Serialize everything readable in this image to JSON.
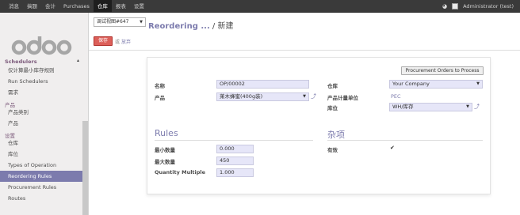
{
  "topbar": {
    "menus": [
      "消息",
      "搞题",
      "会计",
      "Purchases",
      "仓库",
      "报表",
      "设置"
    ],
    "active_menu": "仓库",
    "user": "Administrator (test)"
  },
  "sidebar": {
    "logo": "odoo",
    "sections": [
      {
        "label": "Schedulers",
        "items": [
          "仅计算最小库存规则",
          "Run Schedulers",
          "需求"
        ]
      },
      {
        "label": "产品",
        "items": [
          "产品类别",
          "产品"
        ]
      },
      {
        "label": "设置",
        "items": [
          "仓库",
          "库位",
          "Types of Operation",
          "Reordering Rules",
          "Procurement Rules",
          "Routes"
        ]
      }
    ],
    "active_item": "Reordering Rules"
  },
  "header": {
    "view_selector": "调试视图#647",
    "breadcrumb_parent": "Reordering ...",
    "breadcrumb_sep": " / ",
    "breadcrumb_current": "新建",
    "save_label": "保存",
    "or_label": "或",
    "discard_label": "放弃"
  },
  "form": {
    "procurement_button": "Procurement Orders to Process",
    "name_label": "名称",
    "name_value": "OP/00002",
    "product_label": "产品",
    "product_value": "莱木蜂蜜(400g装)",
    "warehouse_label": "仓库",
    "warehouse_value": "Your Company",
    "uom_label": "产品计量单位",
    "uom_value": "PEC",
    "location_label": "库位",
    "location_value": "WH/库存",
    "rules_heading": "Rules",
    "misc_heading": "杂项",
    "min_qty_label": "最小数量",
    "min_qty_value": "0.000",
    "max_qty_label": "最大数量",
    "max_qty_value": "450",
    "qty_multiple_label": "Quantity Multiple",
    "qty_multiple_value": "1.000",
    "active_label": "有效",
    "active_checked": "✔"
  },
  "colors": {
    "accent": "#7c7bad",
    "save": "#dc5f59",
    "topbar": "#3a3a3a",
    "sidebar": "#f0eeee"
  }
}
